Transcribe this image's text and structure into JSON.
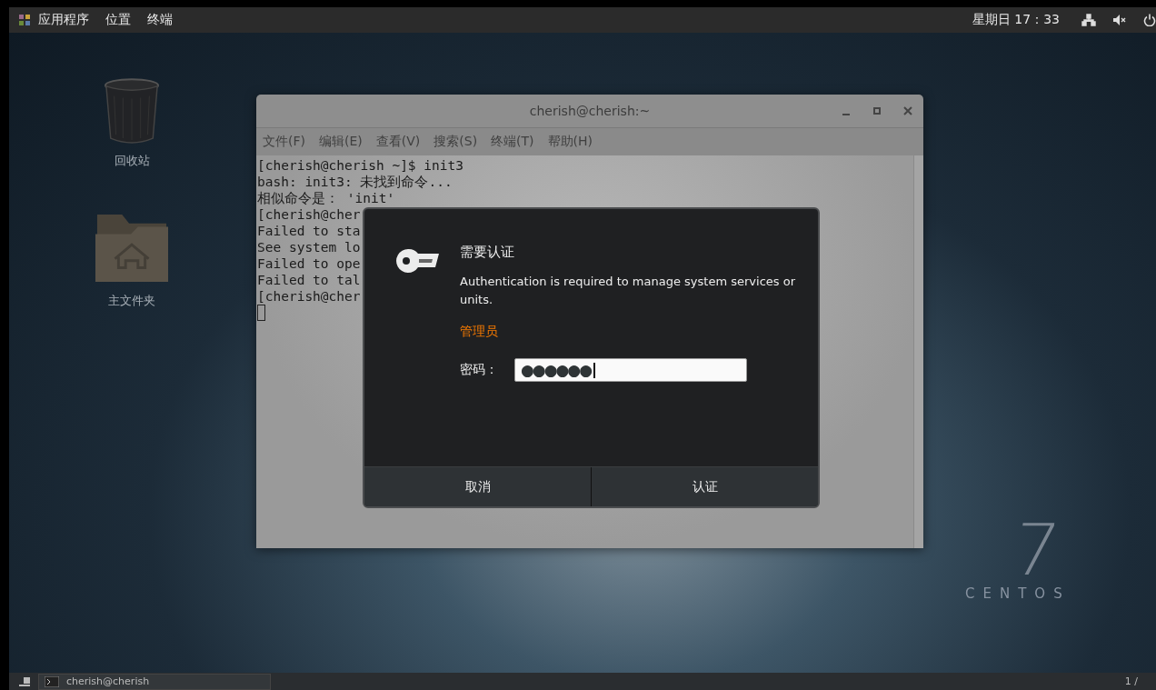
{
  "top_bar": {
    "menus": [
      "应用程序",
      "位置",
      "终端"
    ],
    "clock": "星期日 17：33"
  },
  "desktop_icons": [
    {
      "label": "回收站",
      "kind": "trash"
    },
    {
      "label": "主文件夹",
      "kind": "home"
    }
  ],
  "terminal": {
    "title": "cherish@cherish:~",
    "menu": [
      "文件(F)",
      "编辑(E)",
      "查看(V)",
      "搜索(S)",
      "终端(T)",
      "帮助(H)"
    ],
    "lines": [
      "[cherish@cherish ~]$ init3",
      "bash: init3: 未找到命令...",
      "相似命令是： 'init'",
      "[cherish@cher",
      "Failed to sta",
      "See system lo",
      "Failed to ope",
      "Failed to tal",
      "[cherish@cher"
    ]
  },
  "auth_dialog": {
    "title": "需要认证",
    "message": "Authentication is required to manage system services or units.",
    "user": "管理员",
    "password_label": "密码：",
    "password_value": "●●●●●●",
    "buttons": [
      "取消",
      "认证"
    ]
  },
  "branding": {
    "number": "7",
    "name": "CENTOS"
  },
  "taskbar": {
    "window_button": "cherish@cherish",
    "workspace": "1 /"
  }
}
